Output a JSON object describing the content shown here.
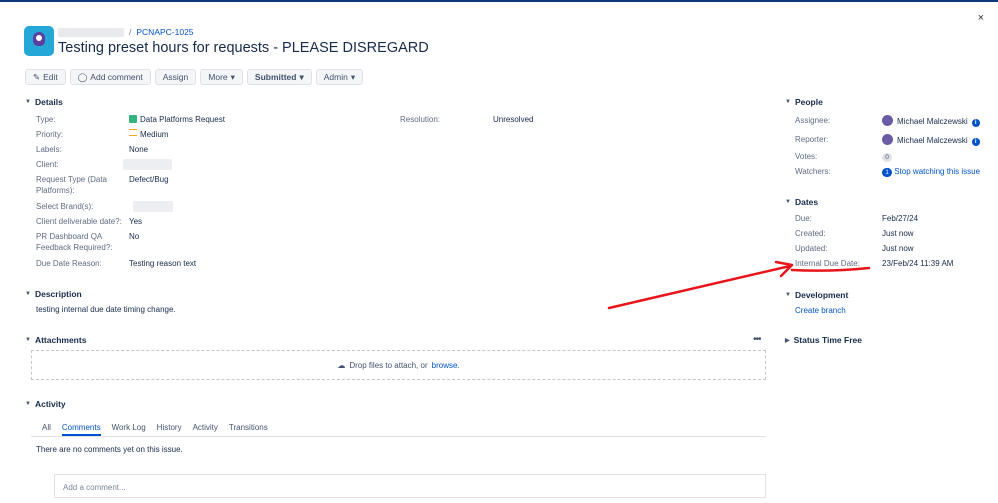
{
  "header": {
    "issue_key": "PCNAPC-1025",
    "breadcrumb_sep": "/",
    "title": "Testing preset hours for requests - PLEASE DISREGARD",
    "close": "×"
  },
  "toolbar": {
    "edit": "Edit",
    "add_comment": "Add comment",
    "assign": "Assign",
    "more": "More",
    "submitted": "Submitted",
    "admin": "Admin"
  },
  "details": {
    "title": "Details",
    "type_label": "Type:",
    "type_value": "Data Platforms Request",
    "priority_label": "Priority:",
    "priority_value": "Medium",
    "labels_label": "Labels:",
    "labels_value": "None",
    "client_label": "Client:",
    "request_type_label": "Request Type (Data Platforms):",
    "request_type_value": "Defect/Bug",
    "brand_label": "Select Brand(s):",
    "deliverable_label": "Client deliverable date?:",
    "deliverable_value": "Yes",
    "qa_label": "PR Dashboard QA Feedback Required?:",
    "qa_value": "No",
    "reason_label": "Due Date Reason:",
    "reason_value": "Testing reason text",
    "resolution_label": "Resolution:",
    "resolution_value": "Unresolved"
  },
  "description": {
    "title": "Description",
    "text": "testing internal due date timing change."
  },
  "attachments": {
    "title": "Attachments",
    "dots": "•••",
    "drop_text": "Drop files to attach, or",
    "browse": "browse."
  },
  "activity": {
    "title": "Activity",
    "tabs": [
      "All",
      "Comments",
      "Work Log",
      "History",
      "Activity",
      "Transitions"
    ],
    "empty": "There are no comments yet on this issue.",
    "placeholder": "Add a comment..."
  },
  "people": {
    "title": "People",
    "assignee_label": "Assignee:",
    "assignee": "Michael Malczewski",
    "reporter_label": "Reporter:",
    "reporter": "Michael Malczewski",
    "votes_label": "Votes:",
    "votes": "0",
    "watchers_label": "Watchers:",
    "watchers_count": "1",
    "watch_link": "Stop watching this issue"
  },
  "dates": {
    "title": "Dates",
    "due_label": "Due:",
    "due": "Feb/27/24",
    "created_label": "Created:",
    "created": "Just now",
    "updated_label": "Updated:",
    "updated": "Just now",
    "internal_label": "Internal Due Date:",
    "internal": "23/Feb/24 11:39 AM"
  },
  "development": {
    "title": "Development",
    "create_branch": "Create branch"
  },
  "status_time": {
    "title": "Status Time Free"
  },
  "colors": {
    "link": "#0052cc",
    "annotation": "#e8141a",
    "brand": "#25a7d8"
  }
}
